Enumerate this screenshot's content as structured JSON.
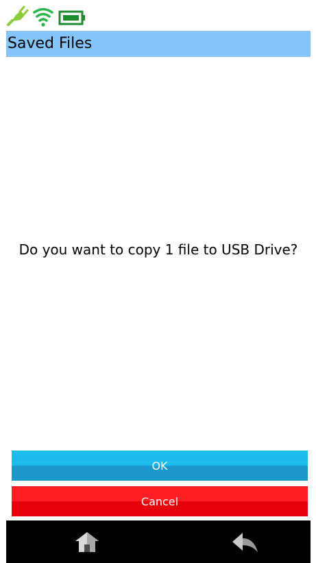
{
  "status_bar": {
    "icons": [
      "plug-icon",
      "wifi-icon",
      "battery-icon"
    ],
    "colors": {
      "plug": "#8ccc3a",
      "wifi": "#2db34a",
      "battery": "#1d8a2e"
    }
  },
  "header": {
    "title": "Saved Files",
    "background": "#86c5fa"
  },
  "dialog": {
    "message": "Do you want to copy 1 file to USB Drive?"
  },
  "buttons": {
    "ok_label": "OK",
    "cancel_label": "Cancel",
    "ok_color": "#1ebcec",
    "cancel_color": "#ff1f24"
  },
  "nav": {
    "icons": [
      "home-icon",
      "back-icon"
    ]
  }
}
